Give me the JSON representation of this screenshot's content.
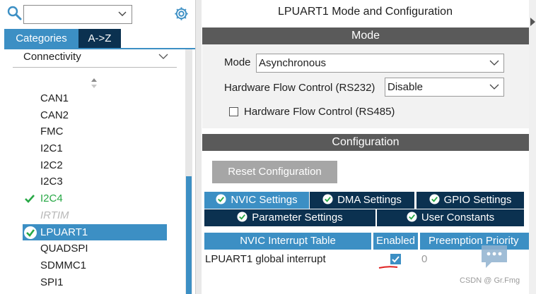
{
  "left": {
    "search": {
      "value": "",
      "placeholder": ""
    },
    "tabs": [
      {
        "label": "Categories",
        "active": true
      },
      {
        "label": "A->Z",
        "active": false
      }
    ],
    "category": "Connectivity",
    "peripherals": [
      {
        "label": "CAN1",
        "state": "normal"
      },
      {
        "label": "CAN2",
        "state": "normal"
      },
      {
        "label": "FMC",
        "state": "normal"
      },
      {
        "label": "I2C1",
        "state": "normal"
      },
      {
        "label": "I2C2",
        "state": "normal"
      },
      {
        "label": "I2C3",
        "state": "normal"
      },
      {
        "label": "I2C4",
        "state": "configured"
      },
      {
        "label": "IRTIM",
        "state": "disabled"
      },
      {
        "label": "LPUART1",
        "state": "selected"
      },
      {
        "label": "QUADSPI",
        "state": "normal"
      },
      {
        "label": "SDMMC1",
        "state": "normal"
      },
      {
        "label": "SPI1",
        "state": "normal"
      }
    ]
  },
  "right": {
    "title": "LPUART1 Mode and Configuration",
    "mode_section": {
      "header": "Mode",
      "mode_label": "Mode",
      "mode_value": "Asynchronous",
      "hw_flow_label": "Hardware Flow Control (RS232)",
      "hw_flow_value": "Disable",
      "rs485_label": "Hardware Flow Control (RS485)",
      "rs485_checked": false
    },
    "config_section": {
      "header": "Configuration",
      "reset_label": "Reset Configuration",
      "tabs_row1": [
        {
          "label": "NVIC Settings",
          "active": true
        },
        {
          "label": "DMA Settings",
          "active": false
        },
        {
          "label": "GPIO Settings",
          "active": false
        }
      ],
      "tabs_row2": [
        {
          "label": "Parameter Settings",
          "active": false
        },
        {
          "label": "User Constants",
          "active": false
        }
      ],
      "table": {
        "headers": [
          "NVIC Interrupt Table",
          "Enabled",
          "Preemption Priority"
        ],
        "rows": [
          {
            "name": "LPUART1 global interrupt",
            "enabled": true,
            "priority": "0"
          }
        ]
      }
    }
  },
  "watermark": "CSDN @ Gr.Fmg",
  "colors": {
    "accent": "#3c8fc4",
    "dark_tab": "#0b3150",
    "section_header": "#5a5a5a",
    "configured_green": "#27a845"
  }
}
